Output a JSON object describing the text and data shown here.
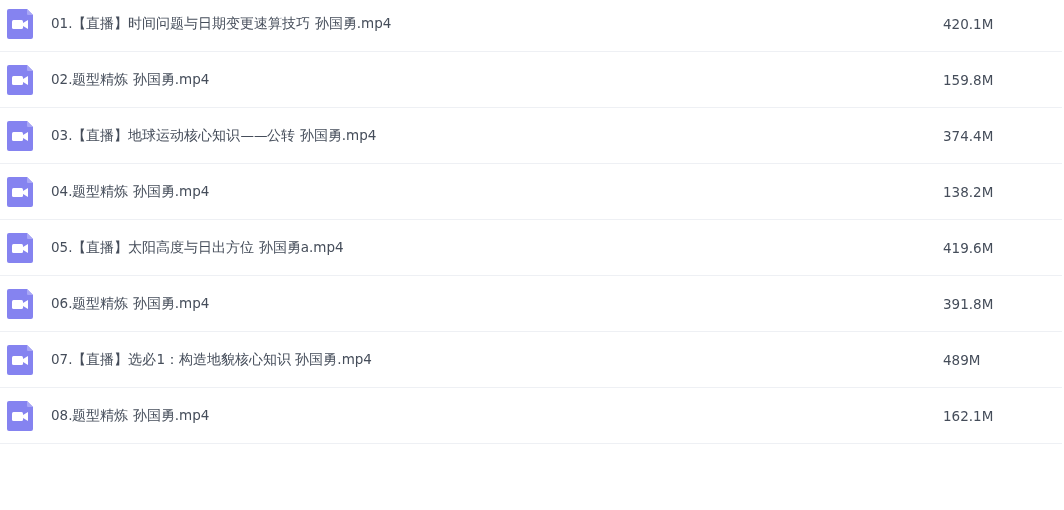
{
  "files": [
    {
      "name": "01.【直播】时间问题与日期变更速算技巧 孙国勇.mp4",
      "size": "420.1M"
    },
    {
      "name": "02.题型精炼 孙国勇.mp4",
      "size": "159.8M"
    },
    {
      "name": "03.【直播】地球运动核心知识——公转 孙国勇.mp4",
      "size": "374.4M"
    },
    {
      "name": "04.题型精炼 孙国勇.mp4",
      "size": "138.2M"
    },
    {
      "name": "05.【直播】太阳高度与日出方位 孙国勇a.mp4",
      "size": "419.6M"
    },
    {
      "name": "06.题型精炼 孙国勇.mp4",
      "size": "391.8M"
    },
    {
      "name": "07.【直播】选必1：构造地貌核心知识 孙国勇.mp4",
      "size": "489M"
    },
    {
      "name": "08.题型精炼 孙国勇.mp4",
      "size": "162.1M"
    }
  ]
}
